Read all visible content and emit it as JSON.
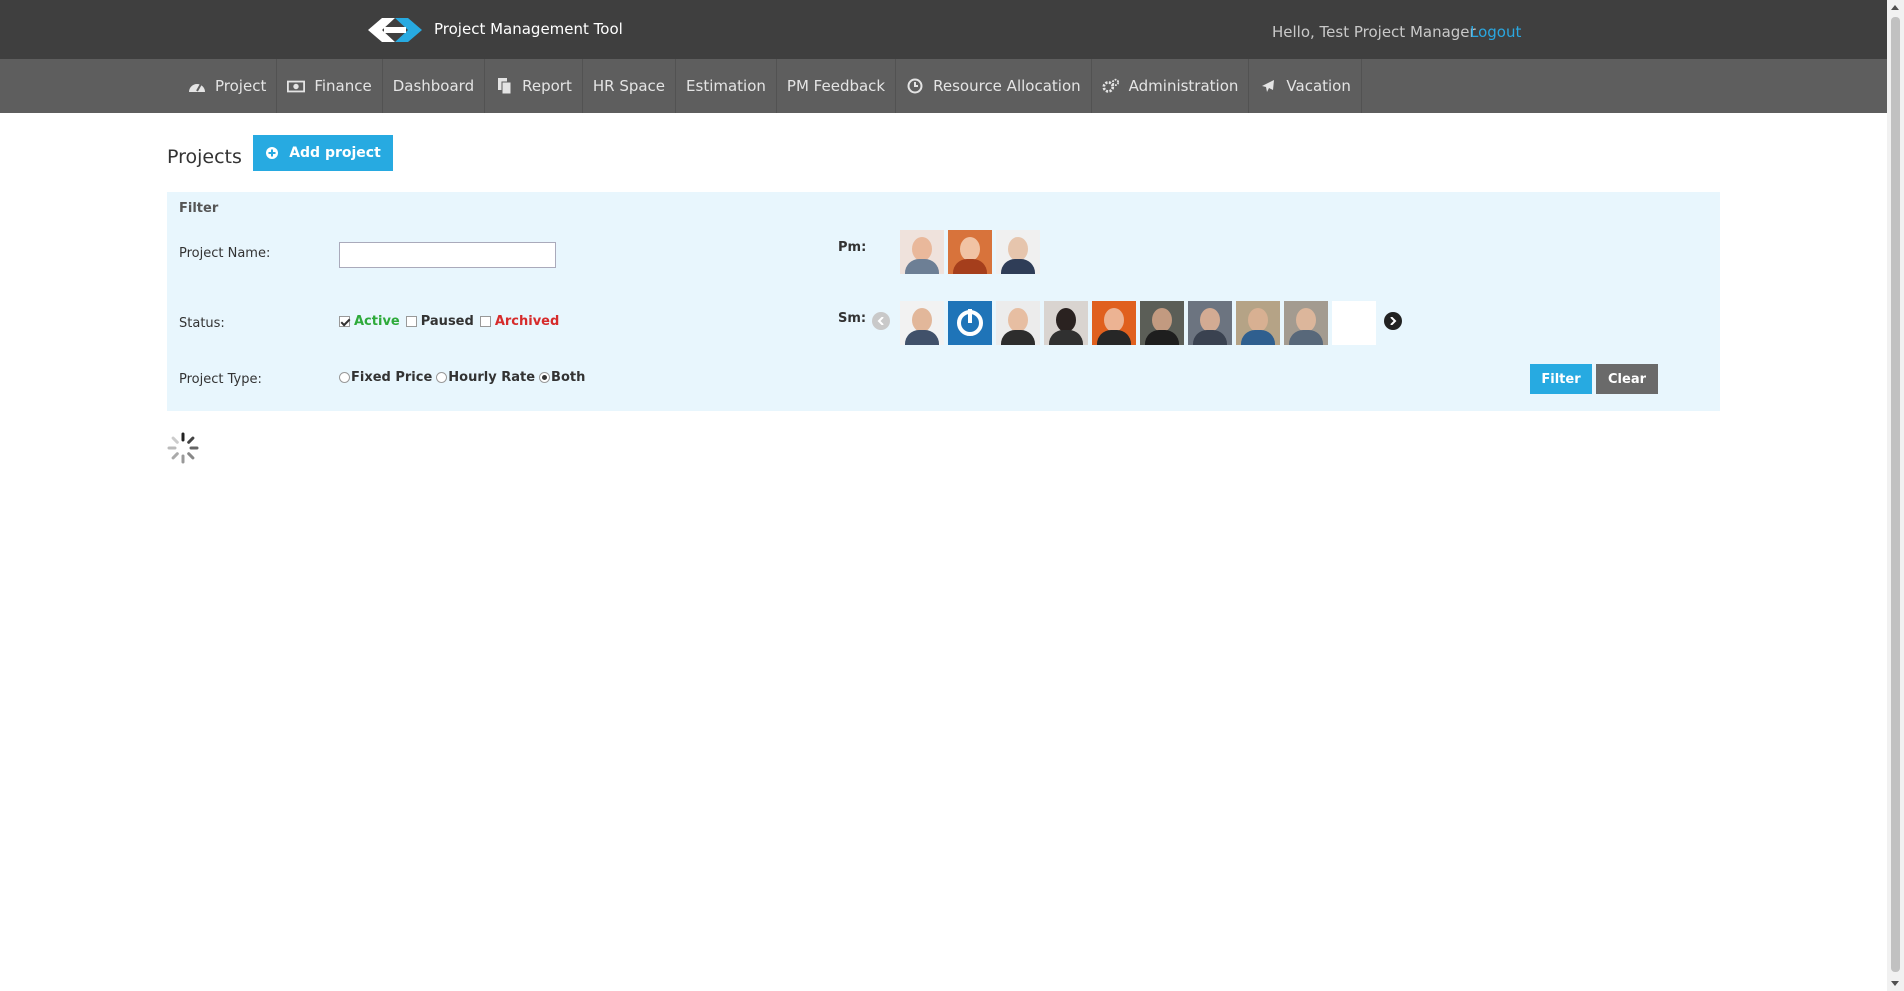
{
  "app": {
    "title": "Project Management Tool"
  },
  "user": {
    "greeting": "Hello, Test Project Manager",
    "logout": "Logout"
  },
  "nav": [
    {
      "label": "Project",
      "icon": "dashboard-icon"
    },
    {
      "label": "Finance",
      "icon": "money-icon"
    },
    {
      "label": "Dashboard",
      "icon": ""
    },
    {
      "label": "Report",
      "icon": "document-icon"
    },
    {
      "label": "HR Space",
      "icon": ""
    },
    {
      "label": "Estimation",
      "icon": ""
    },
    {
      "label": "PM Feedback",
      "icon": ""
    },
    {
      "label": "Resource Allocation",
      "icon": "clock-icon"
    },
    {
      "label": "Administration",
      "icon": "gears-icon"
    },
    {
      "label": "Vacation",
      "icon": "plane-icon"
    }
  ],
  "page": {
    "title": "Projects",
    "add_button": "Add project"
  },
  "filter": {
    "title": "Filter",
    "project_name_label": "Project Name:",
    "project_name_value": "",
    "status_label": "Status:",
    "statuses": [
      {
        "label": "Active",
        "checked": true,
        "color": "#2eaa3a"
      },
      {
        "label": "Paused",
        "checked": false,
        "color": "#333333"
      },
      {
        "label": "Archived",
        "checked": false,
        "color": "#d62b2b"
      }
    ],
    "project_type_label": "Project Type:",
    "project_types": [
      {
        "label": "Fixed Price",
        "selected": false
      },
      {
        "label": "Hourly Rate",
        "selected": false
      },
      {
        "label": "Both",
        "selected": true
      }
    ],
    "pm_label": "Pm:",
    "sm_label": "Sm:",
    "filter_button": "Filter",
    "clear_button": "Clear"
  },
  "colors": {
    "accent": "#27aae1",
    "topbar": "#3f3f3f",
    "navbar": "#5e5e5e",
    "filter_bg": "#e8f6fd"
  }
}
